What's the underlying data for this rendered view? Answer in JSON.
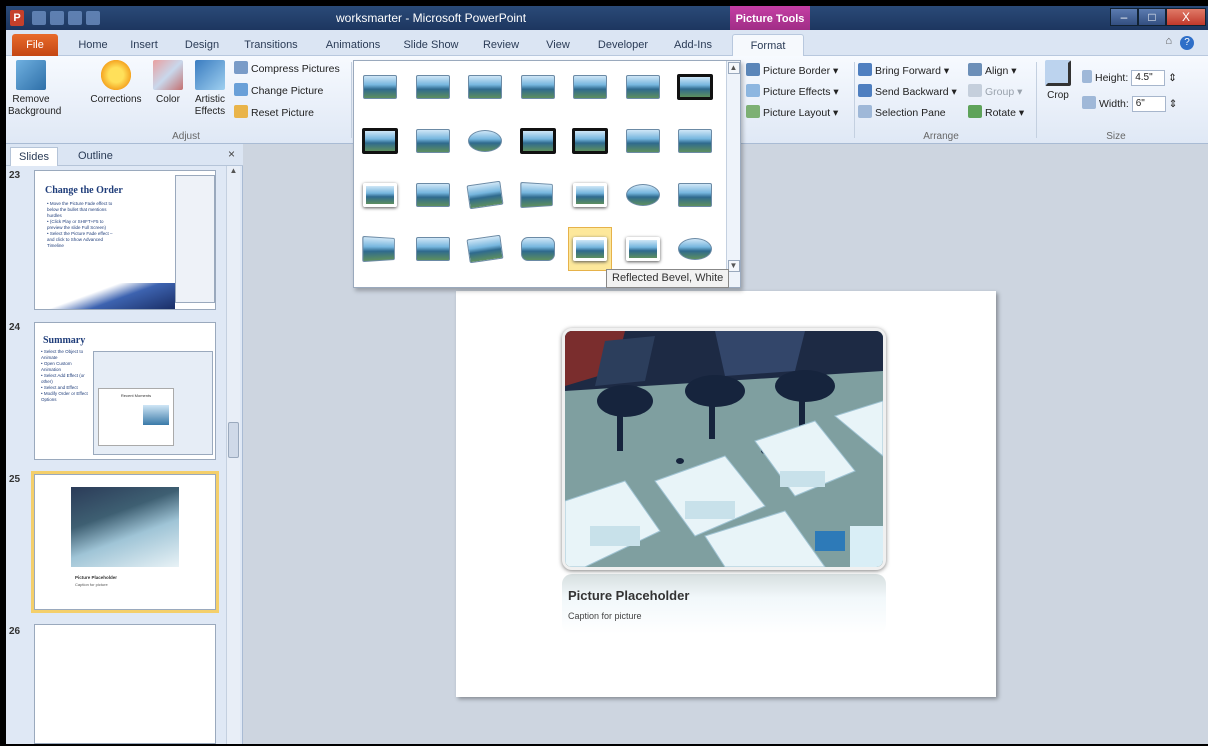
{
  "window": {
    "title": "worksmarter - Microsoft PowerPoint",
    "context_tab": "Picture Tools",
    "app_icon_letter": "P",
    "controls": {
      "minimize": "–",
      "maximize": "□",
      "close": "X"
    },
    "minimize_ribbon_glyph": "⌂",
    "help_glyph": "?"
  },
  "tabs": [
    "File",
    "Home",
    "Insert",
    "Design",
    "Transitions",
    "Animations",
    "Slide Show",
    "Review",
    "View",
    "Developer",
    "Add-Ins",
    "Format"
  ],
  "ribbon": {
    "adjust": {
      "remove_background": "Remove Background",
      "corrections": "Corrections",
      "color": "Color",
      "artistic_effects": "Artistic Effects",
      "compress": "Compress Pictures",
      "change": "Change Picture",
      "reset": "Reset Picture",
      "label": "Adjust"
    },
    "styles": {
      "border": "Picture Border",
      "effects": "Picture Effects",
      "layout": "Picture Layout"
    },
    "arrange": {
      "bring_forward": "Bring Forward",
      "send_backward": "Send Backward",
      "selection_pane": "Selection Pane",
      "align": "Align",
      "group": "Group",
      "rotate": "Rotate",
      "label": "Arrange"
    },
    "size": {
      "crop": "Crop",
      "height_label": "Height:",
      "height_value": "4.5\"",
      "width_label": "Width:",
      "width_value": "6\"",
      "label": "Size"
    }
  },
  "gallery": {
    "tooltip": "Reflected Bevel, White",
    "selected_index": 25,
    "styles": [
      "plain",
      "plain",
      "plain",
      "plain",
      "plain",
      "plain",
      "dark",
      "dark",
      "plain",
      "oval",
      "dark",
      "dark",
      "plain",
      "plain",
      "white",
      "plain",
      "tilt",
      "persp",
      "white",
      "oval",
      "plain",
      "persp",
      "plain",
      "tilt",
      "round",
      "white",
      "white",
      "oval"
    ]
  },
  "pane": {
    "tab_slides": "Slides",
    "tab_outline": "Outline",
    "close": "×",
    "slides": [
      {
        "number": "23",
        "title": "Change the Order",
        "bullets": "• Move the Picture Fade effect to below the bullet that mentions hurdles\n• (Click Play or SHIFT+F5 to preview the slide Full Screen)\n• Select the Picture Fade effect – and click to Show Advanced Timeline"
      },
      {
        "number": "24",
        "title": "Summary",
        "bullets": "• Select the Object to Animate\n• Open Custom Animation\n• Select Add Effect (or other)\n• Select and Effect\n• Modify Order or Effect Options",
        "inner_title": "Recent Moments"
      },
      {
        "number": "25",
        "caption": "Picture Placeholder",
        "subcaption": "Caption for picture"
      },
      {
        "number": "26"
      }
    ]
  },
  "slide": {
    "caption_title": "Picture Placeholder",
    "caption_text": "Caption for picture"
  }
}
